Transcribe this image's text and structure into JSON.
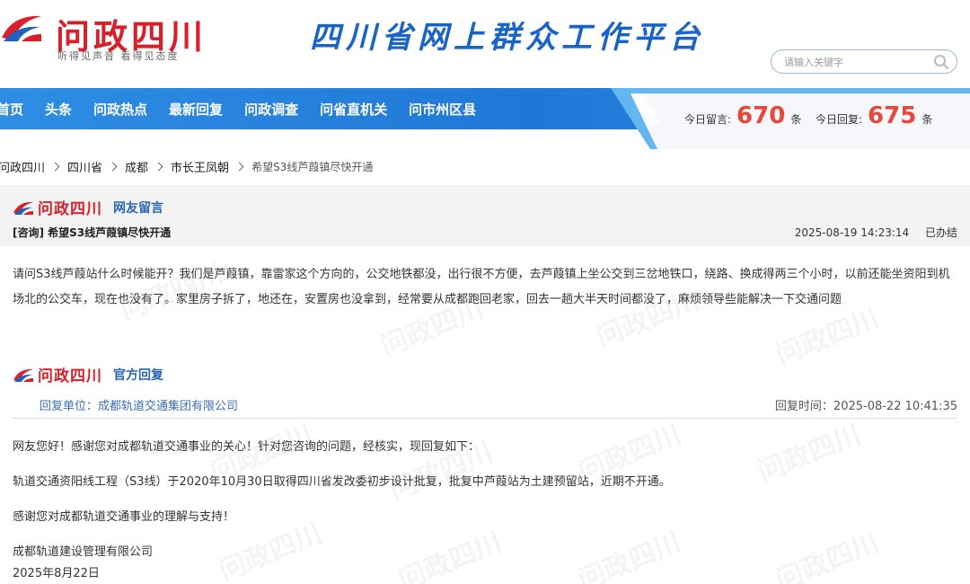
{
  "header": {
    "logo_title": "问政四川",
    "logo_slogan": "听得见声音  看得见态度",
    "platform_title": "四川省网上群众工作平台",
    "search_placeholder": "请输入关键字"
  },
  "nav": {
    "items": [
      "首页",
      "头条",
      "问政热点",
      "最新回复",
      "问政调查",
      "问省直机关",
      "问市州区县"
    ]
  },
  "stats": {
    "today_messages_label": "今日留言:",
    "today_messages_value": "670",
    "today_messages_unit": "条",
    "today_replies_label": "今日回复:",
    "today_replies_value": "675",
    "today_replies_unit": "条"
  },
  "breadcrumb": [
    "问政四川",
    "四川省",
    "成都",
    "市长王凤朝",
    "希望S3线芦葭镇尽快开通"
  ],
  "message": {
    "section_logo": "问政四川",
    "section_label": "网友留言",
    "title": "[咨询] 希望S3线芦葭镇尽快开通",
    "datetime": "2025-08-19 14:23:14",
    "status": "已办结",
    "body": "请问S3线芦葭站什么时候能开？我们是芦葭镇，靠雷家这个方向的，公交地铁都没，出行很不方便，去芦葭镇上坐公交到三岔地铁口，绕路、换成得两三个小时，以前还能坐资阳到机场北的公交车，现在也没有了。家里房子拆了，地还在，安置房也没拿到，经常要从成都跑回老家，回去一趟大半天时间都没了，麻烦领导些能解决一下交通问题"
  },
  "reply": {
    "section_logo": "问政四川",
    "section_label": "官方回复",
    "unit_label": "回复单位：成都轨道交通集团有限公司",
    "time_label": "回复时间：2025-08-22 10:41:35",
    "paragraphs": [
      "网友您好！感谢您对成都轨道交通事业的关心！针对您咨询的问题，经核实，现回复如下：",
      "轨道交通资阳线工程（S3线）于2020年10月30日取得四川省发改委初步设计批复，批复中芦葭站为土建预留站，近期不开通。",
      "感谢您对成都轨道交通事业的理解与支持！",
      "成都轨道建设管理有限公司",
      "2025年8月22日"
    ]
  },
  "colors": {
    "brand_red": "#d9202a",
    "nav_blue": "#1f78d6",
    "stat_red": "#e8473d",
    "label_blue": "#2a64b4"
  }
}
